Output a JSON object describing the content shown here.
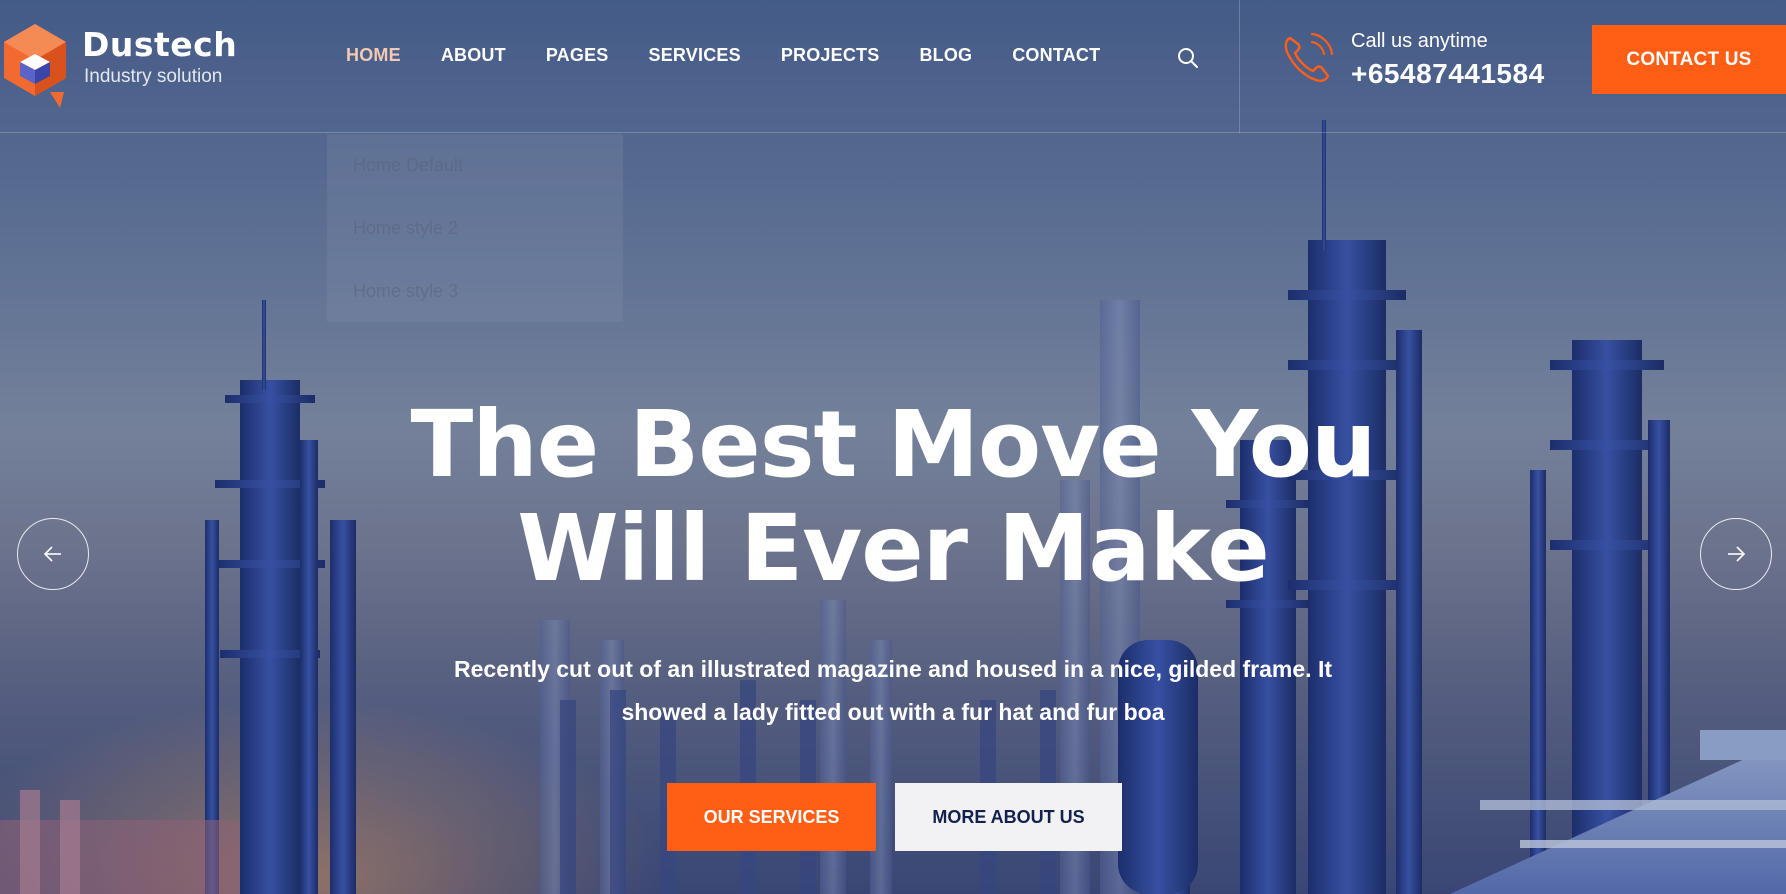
{
  "brand": {
    "name": "Dustech",
    "tagline": "Industry solution"
  },
  "nav": {
    "items": [
      "HOME",
      "ABOUT",
      "PAGES",
      "SERVICES",
      "PROJECTS",
      "BLOG",
      "CONTACT"
    ],
    "active": "HOME"
  },
  "home_dropdown": {
    "items": [
      "Home Default",
      "Home style 2",
      "Home style 3"
    ]
  },
  "header": {
    "search_icon": "search-icon",
    "phone_icon": "phone-icon",
    "call_label": "Call us anytime",
    "call_number": "+65487441584",
    "contact_button": "CONTACT US"
  },
  "hero": {
    "title_line1": "The Best Move You",
    "title_line2": "Will Ever Make",
    "subtitle_line1": "Recently cut out of an illustrated magazine and housed in a nice, gilded frame. It",
    "subtitle_line2": "showed a lady fitted out with a fur hat and fur boa",
    "primary_button": "OUR SERVICES",
    "secondary_button": "MORE ABOUT US",
    "prev_icon": "arrow-left-icon",
    "next_icon": "arrow-right-icon"
  },
  "colors": {
    "accent": "#ff5e14",
    "dark_navy": "#12224d",
    "white": "#ffffff"
  }
}
